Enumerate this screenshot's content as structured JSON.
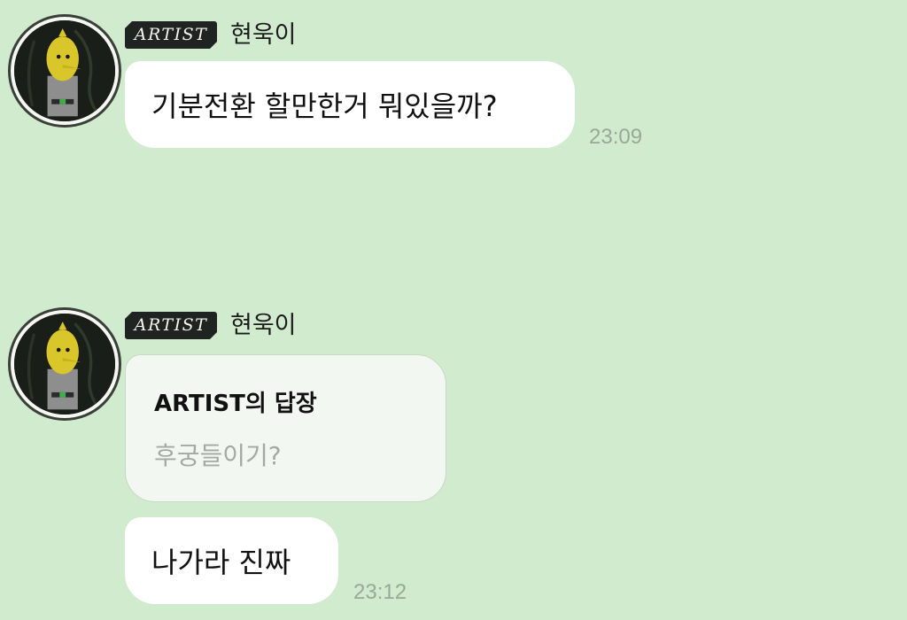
{
  "messages": [
    {
      "sender_badge": "ARTIST",
      "sender_name": "현욱이",
      "text": "기분전환 할만한거 뭐있을까?",
      "time": "23:09"
    },
    {
      "sender_badge": "ARTIST",
      "sender_name": "현욱이",
      "reply": {
        "title": "ARTIST의 답장",
        "quoted_text": "후궁들이기?"
      },
      "text": "나가라 진짜",
      "time": "23:12"
    }
  ],
  "colors": {
    "background": "#d1ebcf",
    "bubble": "#ffffff",
    "reply_card": "#f2f7f1",
    "badge": "#1f2422",
    "timestamp": "#9aa898"
  },
  "icons": {
    "avatar": "lemon-character-avatar"
  }
}
